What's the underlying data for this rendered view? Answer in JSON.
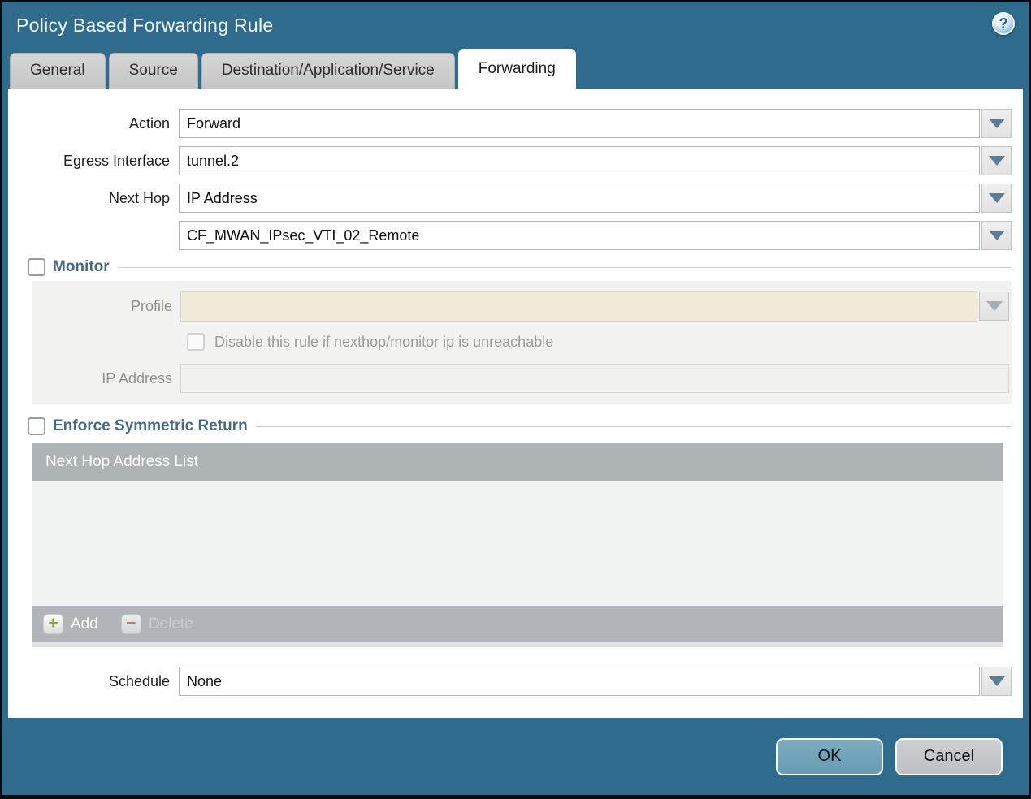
{
  "dialog": {
    "title": "Policy Based Forwarding Rule",
    "help_glyph": "?"
  },
  "tabs": [
    {
      "label": "General",
      "active": false
    },
    {
      "label": "Source",
      "active": false
    },
    {
      "label": "Destination/Application/Service",
      "active": false
    },
    {
      "label": "Forwarding",
      "active": true
    }
  ],
  "form": {
    "action": {
      "label": "Action",
      "value": "Forward"
    },
    "egress_interface": {
      "label": "Egress Interface",
      "value": "tunnel.2"
    },
    "next_hop": {
      "label": "Next Hop",
      "value": "IP Address"
    },
    "next_hop_address": {
      "value": "CF_MWAN_IPsec_VTI_02_Remote"
    },
    "schedule": {
      "label": "Schedule",
      "value": "None"
    }
  },
  "monitor": {
    "legend": "Monitor",
    "checked": false,
    "profile_label": "Profile",
    "profile_value": "",
    "disable_checkbox_label": "Disable this rule if nexthop/monitor ip is unreachable",
    "disable_checked": false,
    "ip_address_label": "IP Address",
    "ip_address_value": ""
  },
  "symmetric_return": {
    "legend": "Enforce Symmetric Return",
    "checked": false,
    "table_header": "Next Hop Address List",
    "rows": [],
    "add_label": "Add",
    "delete_label": "Delete",
    "delete_enabled": false
  },
  "footer": {
    "ok_label": "OK",
    "cancel_label": "Cancel"
  },
  "colors": {
    "frame_teal": "#2E6B8C",
    "ok_button": "#6FA2B7",
    "cancel_button": "#C3C6C9",
    "beige_disabled_input": "#F0EBD8",
    "table_header_gray": "#AEB3B6",
    "legend_text": "#48697F",
    "add_plus_green": "#8CA433",
    "delete_minus_red": "#B17D75"
  }
}
